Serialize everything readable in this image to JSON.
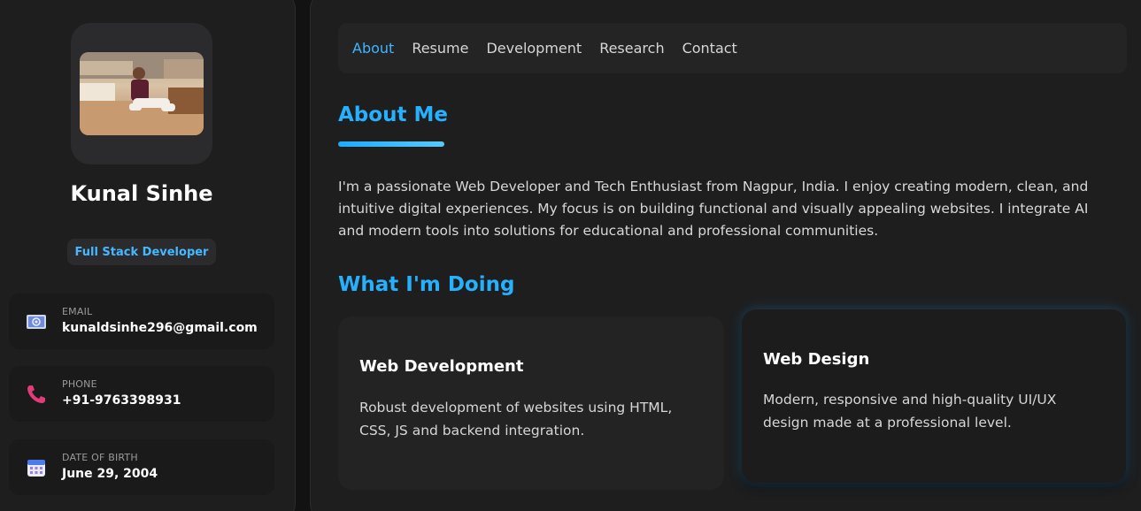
{
  "profile": {
    "name": "Kunal Sinhe",
    "role": "Full Stack Developer",
    "photo_alt": "profile-photo"
  },
  "contacts": [
    {
      "label": "EMAIL",
      "value": "kunaldsinhe296@gmail.com",
      "icon": "email-icon"
    },
    {
      "label": "PHONE",
      "value": "+91-9763398931",
      "icon": "phone-icon"
    },
    {
      "label": "DATE OF BIRTH",
      "value": "June 29, 2004",
      "icon": "calendar-icon"
    }
  ],
  "nav": {
    "items": [
      "About",
      "Resume",
      "Development",
      "Research",
      "Contact"
    ],
    "active": "About"
  },
  "about": {
    "heading": "About Me",
    "text": "I'm a passionate Web Developer and Tech Enthusiast from Nagpur, India. I enjoy creating modern, clean, and intuitive digital experiences. My focus is on building functional and visually appealing websites. I integrate AI and modern tools into solutions for educational and professional communities."
  },
  "services": {
    "heading": "What I'm Doing",
    "items": [
      {
        "title": "Web Development",
        "desc": "Robust development of websites using HTML, CSS, JS and backend integration."
      },
      {
        "title": "Web Design",
        "desc": "Modern, responsive and high-quality UI/UX design made at a professional level."
      }
    ]
  },
  "colors": {
    "accent": "#26b1ff",
    "background": "#121212",
    "panel": "#1e1e1f"
  }
}
